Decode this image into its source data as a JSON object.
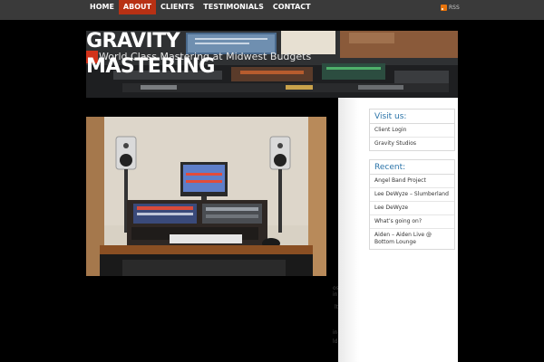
{
  "nav": {
    "items": [
      {
        "label": "HOME",
        "active": false
      },
      {
        "label": "ABOUT",
        "active": true
      },
      {
        "label": "CLIENTS",
        "active": false
      },
      {
        "label": "TESTIMONIALS",
        "active": false
      },
      {
        "label": "CONTACT",
        "active": false
      }
    ],
    "rss_label": "RSS"
  },
  "header": {
    "logo_line1": "GRAVITY",
    "logo_line2": "MASTERING",
    "tagline": "World Class Mastering at Midwest Budgets"
  },
  "main": {
    "snippets": [
      "os in",
      "lts",
      "ing",
      "ld-"
    ]
  },
  "sidebar": {
    "visit": {
      "title": "Visit us:",
      "links": [
        "Client Login",
        "Gravity Studios"
      ]
    },
    "recent": {
      "title": "Recent:",
      "posts": [
        "Angel Band Project",
        "Lee DeWyze – Slumberland",
        "Lee DeWyze",
        "What’s going on?",
        "Aiden – Aiden Live @ Bottom Lounge"
      ]
    }
  },
  "colors": {
    "accent": "#b83114",
    "link_blue": "#2a73a8",
    "topbar": "#3a3a3a"
  }
}
